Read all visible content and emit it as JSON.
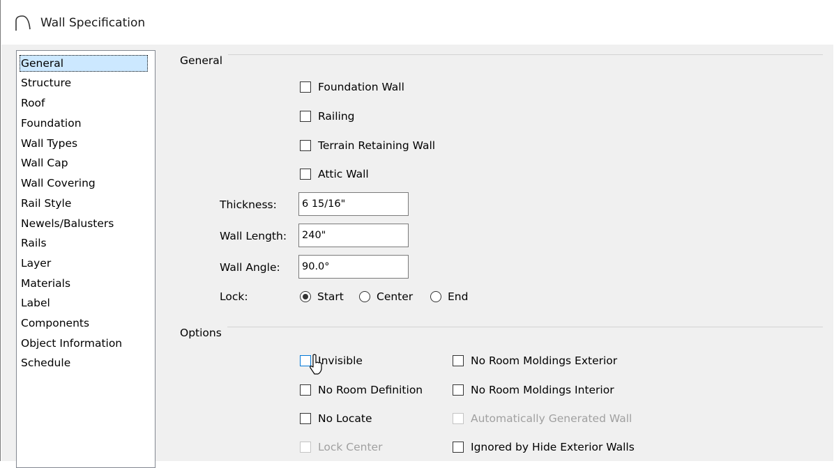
{
  "window": {
    "title": "Wall Specification",
    "icon": "wall-arc-icon"
  },
  "nav": {
    "selected": "General",
    "items": [
      {
        "label": "General"
      },
      {
        "label": "Structure"
      },
      {
        "label": "Roof"
      },
      {
        "label": "Foundation"
      },
      {
        "label": "Wall Types"
      },
      {
        "label": "Wall Cap"
      },
      {
        "label": "Wall Covering"
      },
      {
        "label": "Rail Style"
      },
      {
        "label": "Newels/Balusters"
      },
      {
        "label": "Rails"
      },
      {
        "label": "Layer"
      },
      {
        "label": "Materials"
      },
      {
        "label": "Label"
      },
      {
        "label": "Components"
      },
      {
        "label": "Object Information"
      },
      {
        "label": "Schedule"
      }
    ]
  },
  "general": {
    "group_label": "General",
    "checkboxes": [
      {
        "label": "Foundation Wall",
        "checked": false
      },
      {
        "label": "Railing",
        "checked": false
      },
      {
        "label": "Terrain Retaining Wall",
        "checked": false
      },
      {
        "label": "Attic Wall",
        "checked": false
      }
    ],
    "thickness": {
      "label": "Thickness:",
      "value": "6 15/16\""
    },
    "wall_length": {
      "label": "Wall Length:",
      "value": "240\""
    },
    "wall_angle": {
      "label": "Wall Angle:",
      "value": "90.0°"
    },
    "lock": {
      "label": "Lock:",
      "selected": "Start",
      "options": [
        {
          "label": "Start"
        },
        {
          "label": "Center"
        },
        {
          "label": "End"
        }
      ]
    }
  },
  "options": {
    "group_label": "Options",
    "left": [
      {
        "label": "Invisible",
        "checked": false,
        "enabled": true
      },
      {
        "label": "No Room Definition",
        "checked": false,
        "enabled": true
      },
      {
        "label": "No Locate",
        "checked": false,
        "enabled": true
      },
      {
        "label": "Lock Center",
        "checked": false,
        "enabled": false
      }
    ],
    "right": [
      {
        "label": "No Room Moldings Exterior",
        "checked": false,
        "enabled": true
      },
      {
        "label": "No Room Moldings Interior",
        "checked": false,
        "enabled": true
      },
      {
        "label": "Automatically Generated Wall",
        "checked": false,
        "enabled": false
      },
      {
        "label": "Ignored by Hide Exterior Walls",
        "checked": false,
        "enabled": true
      }
    ]
  },
  "colors": {
    "selection": "#cce8ff",
    "dialog_bg": "#f0f0f0",
    "disabled_text": "#a0a0a0",
    "hover_border": "#0078d7"
  }
}
